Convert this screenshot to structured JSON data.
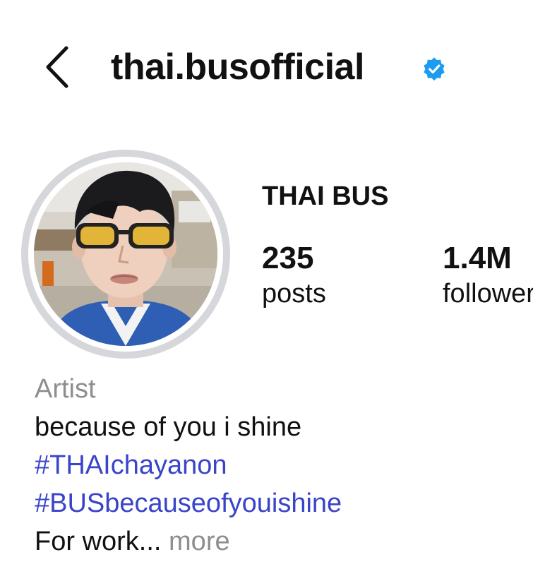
{
  "header": {
    "back_icon": "chevron-left-icon",
    "username": "thai.busofficial",
    "verified_icon": "verified-badge-icon",
    "verified_color": "#1d9bf0"
  },
  "profile": {
    "avatar_ring_color": "#d6d7db",
    "display_name": "THAI BUS",
    "stats": {
      "posts_value": "235",
      "posts_label": "posts",
      "followers_value": "1.4M",
      "followers_label": "followers"
    }
  },
  "bio": {
    "category": "Artist",
    "text": "because of you i shine",
    "hashtag_1": "#THAIchayanon",
    "hashtag_2": "#BUSbecauseofyouishine",
    "truncated_text": "For work...",
    "more_label": "more",
    "hashtag_color": "#3a44c8"
  }
}
